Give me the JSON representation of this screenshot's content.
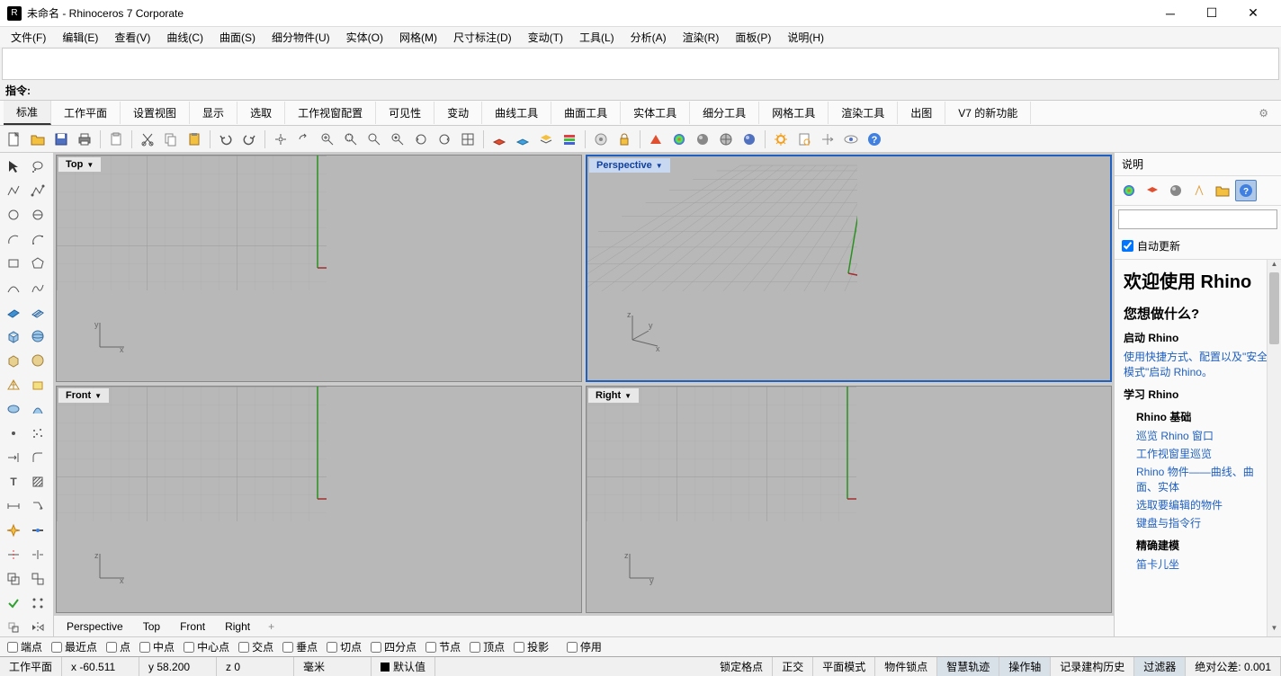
{
  "title": "未命名 - Rhinoceros 7 Corporate",
  "menu": [
    "文件(F)",
    "编辑(E)",
    "查看(V)",
    "曲线(C)",
    "曲面(S)",
    "细分物件(U)",
    "实体(O)",
    "网格(M)",
    "尺寸标注(D)",
    "变动(T)",
    "工具(L)",
    "分析(A)",
    "渲染(R)",
    "面板(P)",
    "说明(H)"
  ],
  "command_label": "指令:",
  "tabs": [
    "标准",
    "工作平面",
    "设置视图",
    "显示",
    "选取",
    "工作视窗配置",
    "可见性",
    "变动",
    "曲线工具",
    "曲面工具",
    "实体工具",
    "细分工具",
    "网格工具",
    "渲染工具",
    "出图",
    "V7 的新功能"
  ],
  "viewports": {
    "tl": "Top",
    "tr": "Perspective",
    "bl": "Front",
    "br": "Right"
  },
  "viewtabs": [
    "Perspective",
    "Top",
    "Front",
    "Right"
  ],
  "panel": {
    "header": "说明",
    "auto_update": "自动更新",
    "welcome": "欢迎使用 Rhino",
    "whatdo": "您想做什么?",
    "start_h": "启动 Rhino",
    "start_link": "使用快捷方式、配置以及\"安全模式\"启动 Rhino。",
    "learn_h": "学习 Rhino",
    "basics_h": "Rhino 基础",
    "links": [
      "巡览 Rhino 窗口",
      "工作视窗里巡览",
      "Rhino 物件——曲线、曲面、实体",
      "选取要编辑的物件",
      "键盘与指令行"
    ],
    "precise_h": "精确建模",
    "precise1": "笛卡儿坐"
  },
  "osnap": [
    "端点",
    "最近点",
    "点",
    "中点",
    "中心点",
    "交点",
    "垂点",
    "切点",
    "四分点",
    "节点",
    "顶点",
    "投影",
    "停用"
  ],
  "status": {
    "cplane": "工作平面",
    "x": "x -60.511",
    "y": "y 58.200",
    "z": "z 0",
    "units": "毫米",
    "layer": "默认值",
    "items": [
      "锁定格点",
      "正交",
      "平面模式",
      "物件锁点",
      "智慧轨迹",
      "操作轴",
      "记录建构历史",
      "过滤器"
    ],
    "tol": "绝对公差: 0.001"
  }
}
